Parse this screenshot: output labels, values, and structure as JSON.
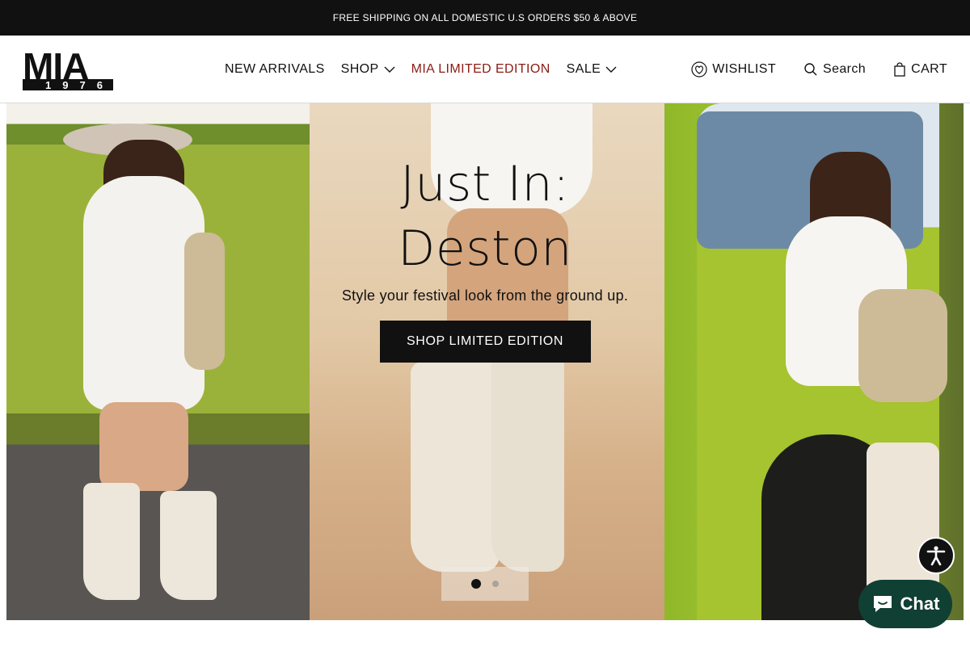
{
  "announcement": {
    "text": "FREE SHIPPING ON ALL DOMESTIC U.S ORDERS $50 & ABOVE"
  },
  "brand": {
    "logo_text": "MIA",
    "logo_sub": "1976"
  },
  "nav": {
    "items": [
      {
        "label": "NEW ARRIVALS"
      },
      {
        "label": "SHOP"
      },
      {
        "label": "MIA LIMITED EDITION"
      },
      {
        "label": "SALE"
      }
    ]
  },
  "utilities": {
    "wishlist": "WISHLIST",
    "search": "Search",
    "cart": "CART"
  },
  "hero": {
    "title": "Just In: Deston",
    "subtitle": "Style your festival look from the ground up.",
    "cta": "SHOP LIMITED EDITION",
    "slides_total": 2,
    "active_slide": 1
  },
  "chat": {
    "label": "Chat"
  },
  "colors": {
    "accent": "#8a1c14",
    "dark": "#111111",
    "chat_green": "#103f33"
  }
}
